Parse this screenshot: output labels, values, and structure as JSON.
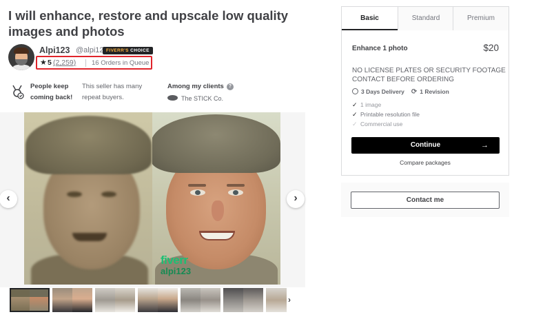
{
  "gig": {
    "title": "I will enhance, restore and upscale low quality images and photos"
  },
  "seller": {
    "name": "Alpi123",
    "handle": "@alpi123",
    "badge_part1": "FIVERR'S",
    "badge_part2": "CHOICE",
    "rating": "5",
    "rating_count": "(2,259)",
    "orders_in_queue": "16 Orders in Queue"
  },
  "highlights": {
    "title": "People keep coming back!",
    "description": "This seller has many repeat buyers.",
    "clients_title": "Among my clients",
    "client_name": "The STICK Co."
  },
  "gallery": {
    "watermark_brand": "fiverr",
    "watermark_user": "alpi123",
    "prev_icon": "‹",
    "next_icon": "›",
    "thumb_next_icon": "›",
    "thumb_count": 7
  },
  "packages": {
    "tabs": [
      "Basic",
      "Standard",
      "Premium"
    ],
    "active_tab": "Basic",
    "name": "Enhance 1 photo",
    "price": "$20",
    "description": "NO LICENSE PLATES OR SECURITY FOOTAGE CONTACT BEFORE ORDERING",
    "delivery": "3 Days Delivery",
    "revisions": "1 Revision",
    "features": [
      {
        "label": "1 image",
        "included": true
      },
      {
        "label": "Printable resolution file",
        "included": true
      },
      {
        "label": "Commercial use",
        "included": false
      }
    ],
    "continue_label": "Continue",
    "continue_arrow": "→",
    "compare_label": "Compare packages"
  },
  "contact": {
    "label": "Contact me"
  },
  "colors": {
    "brand_green": "#1dbf73",
    "highlight_red": "#e0242b",
    "continue_bg": "#000000"
  }
}
